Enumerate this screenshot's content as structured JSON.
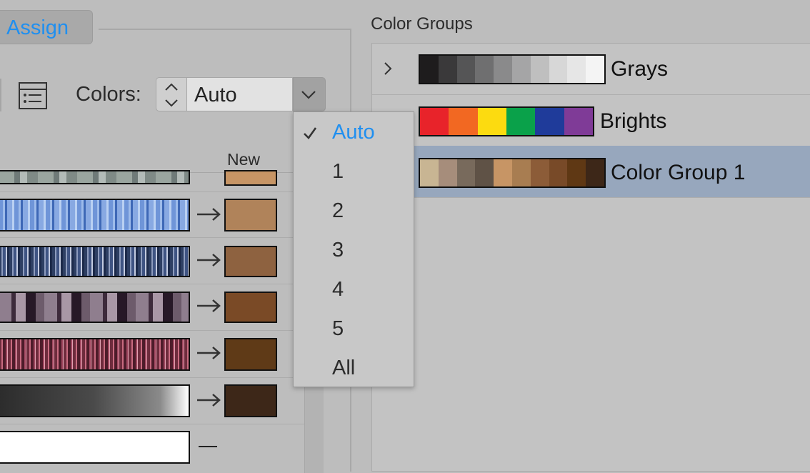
{
  "assign_tab": {
    "label": "Assign"
  },
  "toolbar": {
    "colors_label": "Colors:",
    "colors_value": "Auto"
  },
  "table": {
    "new_header": "New",
    "rows": [
      {
        "new_color": "#c79565",
        "has_arrow": false
      },
      {
        "new_color": "#b0835a",
        "has_arrow": true
      },
      {
        "new_color": "#8e6240",
        "has_arrow": true
      },
      {
        "new_color": "#7a4a26",
        "has_arrow": true
      },
      {
        "new_color": "#5f3a17",
        "has_arrow": true
      },
      {
        "new_color": "#3d2718",
        "has_arrow": true
      },
      {
        "new_color": null,
        "has_arrow": false
      }
    ]
  },
  "dropdown": {
    "options": [
      "Auto",
      "1",
      "2",
      "3",
      "4",
      "5",
      "All"
    ],
    "selected": "Auto"
  },
  "color_groups": {
    "title": "Color Groups",
    "groups": [
      {
        "name": "Grays",
        "colors": [
          "#1e1c1d",
          "#3a393a",
          "#555556",
          "#6f6f70",
          "#8a8a8b",
          "#a5a5a6",
          "#bfbfbf",
          "#d7d7d7",
          "#e6e6e6",
          "#f4f4f4"
        ]
      },
      {
        "name": "Brights",
        "colors": [
          "#e8232a",
          "#f26822",
          "#fcdb10",
          "#0aa14a",
          "#1f3b9a",
          "#7f3b97"
        ]
      },
      {
        "name": "Color Group 1",
        "colors": [
          "#c8b593",
          "#a68d7b",
          "#786a5c",
          "#5f5246",
          "#c79565",
          "#a87d51",
          "#8c5c38",
          "#784a28",
          "#5f3814",
          "#3d2718"
        ]
      }
    ]
  },
  "colors": {
    "accent": "#1f8ff0",
    "selection": "#97a7bd",
    "panel_bg": "#bdbdbd"
  }
}
